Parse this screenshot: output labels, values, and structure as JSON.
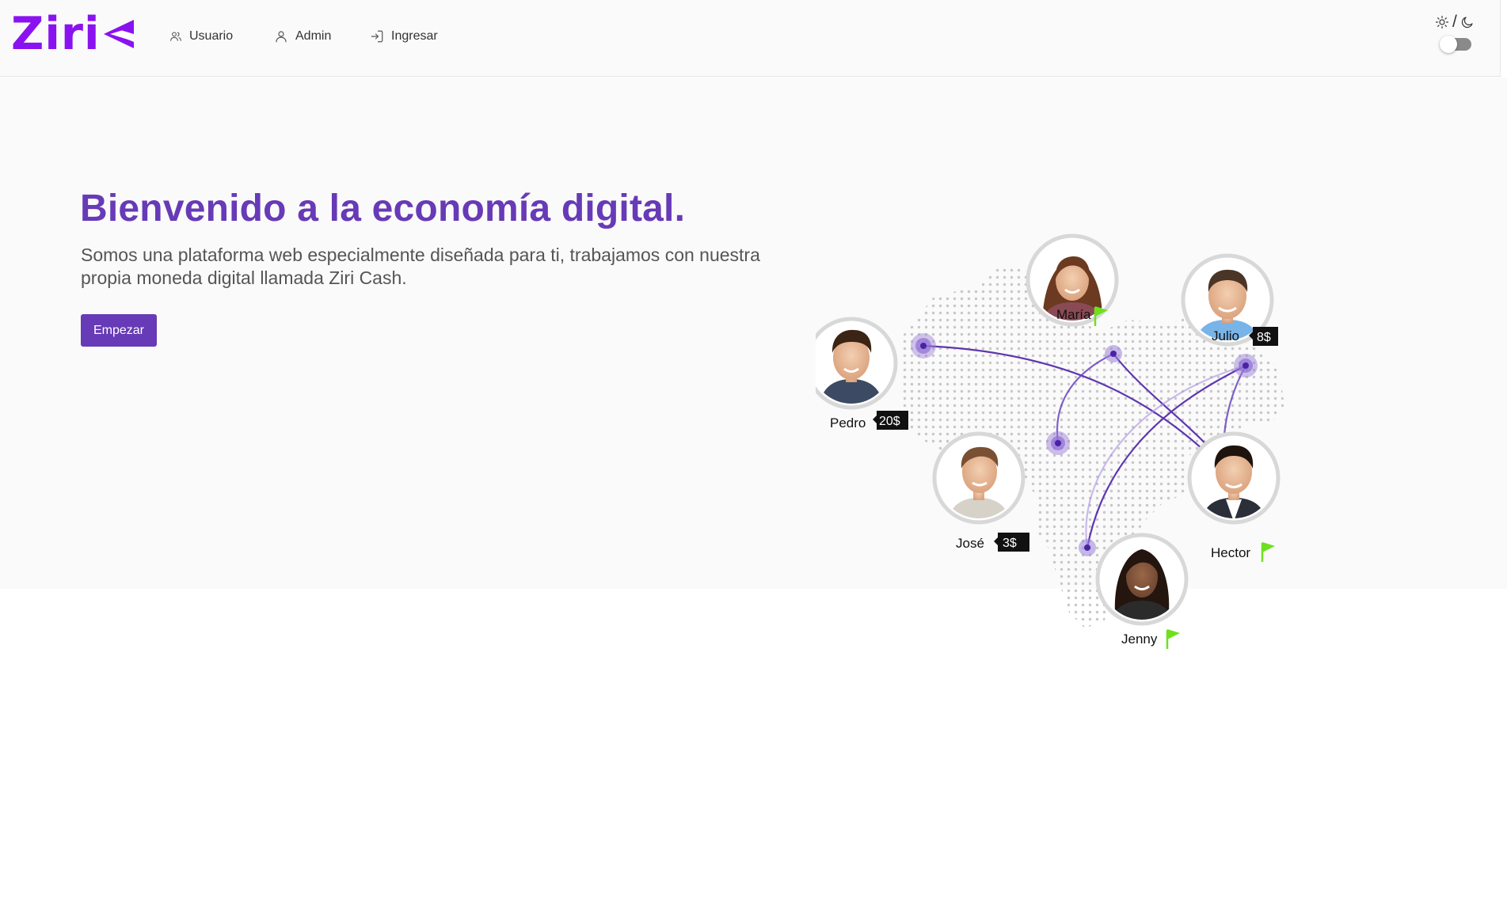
{
  "brand": {
    "logo_text": "Ziri",
    "accent_color": "#673ab7",
    "logo_color": "#8a12f0"
  },
  "nav": {
    "items": [
      {
        "label": "Usuario",
        "icon": "users-icon"
      },
      {
        "label": "Admin",
        "icon": "user-icon"
      },
      {
        "label": "Ingresar",
        "icon": "login-icon"
      }
    ]
  },
  "theme_toggle": {
    "light_icon": "sun-icon",
    "separator": "/",
    "dark_icon": "moon-icon",
    "dark_mode_enabled": false
  },
  "hero": {
    "title": "Bienvenido a la economía digital.",
    "description": "Somos una plataforma web especialmente diseñada para ti, trabajamos con nuestra propia moneda digital llamada Ziri Cash.",
    "button_label": "Empezar"
  },
  "illustration": {
    "people": [
      {
        "name": "Pedro",
        "badge": "20$"
      },
      {
        "name": "María",
        "badge": "flag"
      },
      {
        "name": "Julio",
        "badge": "8$"
      },
      {
        "name": "José",
        "badge": "3$"
      },
      {
        "name": "Hector",
        "badge": "flag"
      },
      {
        "name": "Jenny",
        "badge": "flag"
      }
    ],
    "flag_color": "#6fe01e",
    "line_color": "#5e35b1",
    "node_color": "#9b7fd8"
  }
}
